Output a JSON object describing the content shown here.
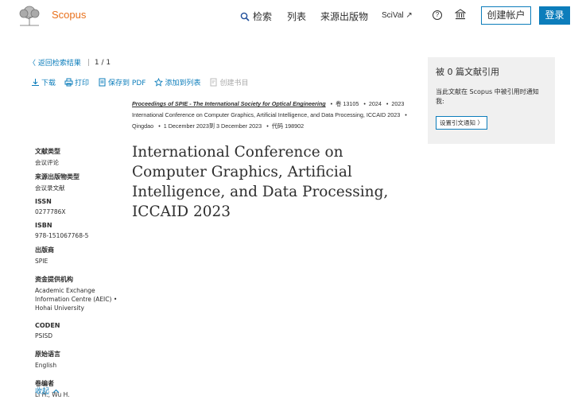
{
  "header": {
    "brand": "Scopus",
    "nav_search": "检索",
    "nav_lists": "列表",
    "nav_sources": "来源出版物",
    "nav_scival": "SciVal ↗",
    "help_glyph": "?",
    "create_account": "创建帐户",
    "login": "登录"
  },
  "back": {
    "label": "〈 返回检索结果",
    "pager": "1 / 1"
  },
  "toolbar": {
    "download": "下载",
    "print": "打印",
    "save_pdf": "保存到 PDF",
    "add_list": "添加到列表",
    "create_bib": "创建书目"
  },
  "source": {
    "title": "Proceedings of SPIE - The International Society for Optical Engineering",
    "volume": "卷 13105",
    "year": "2024",
    "pages": "2023",
    "conference": "International Conference on Computer Graphics, Artificial Intelligence, and Data Processing, ICCAID 2023",
    "location": "Qingdao",
    "dates": "1 December 2023到 3 December 2023",
    "code": "代码 198902"
  },
  "document": {
    "title": "International Conference on Computer Graphics, Artificial Intelligence, and Data Processing, ICCAID 2023"
  },
  "metadata": {
    "doc_type_label": "文献类型",
    "doc_type": "会议评论",
    "source_type_label": "来源出版物类型",
    "source_type": "会议录文献",
    "issn_label": "ISSN",
    "issn": "0277786X",
    "isbn_label": "ISBN",
    "isbn": "978-151067768-5",
    "publisher_label": "出版商",
    "publisher": "SPIE",
    "funding_label": "资金提供机构",
    "funding": "Academic Exchange Information Centre (AEIC) • Hohai University",
    "coden_label": "CODEN",
    "coden": "PSISD",
    "language_label": "原始语言",
    "language": "English",
    "editors_label": "卷编者",
    "editors": "Li H., Wu H.",
    "collapse": "收起"
  },
  "cite_panel": {
    "title": "被 0 篇文献引用",
    "desc": "当此文献在 Scopus 中被引用时通知我:",
    "button": "设置引文通知 〉"
  },
  "colors": {
    "brand": "#e9711c",
    "link": "#0c7dbb",
    "panel_bg": "#f0f0f0"
  }
}
